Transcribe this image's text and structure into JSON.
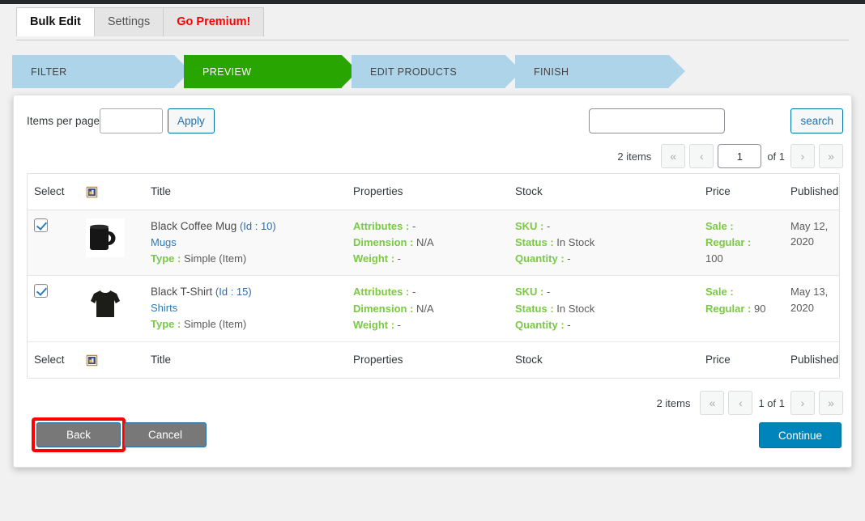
{
  "tabs": [
    {
      "label": "Bulk Edit",
      "state": "active"
    },
    {
      "label": "Settings",
      "state": "inactive"
    },
    {
      "label": "Go Premium!",
      "state": "premium"
    }
  ],
  "steps": [
    {
      "label": "FILTER",
      "current": false
    },
    {
      "label": "PREVIEW",
      "current": true
    },
    {
      "label": "EDIT PRODUCTS",
      "current": false
    },
    {
      "label": "FINISH",
      "current": false
    }
  ],
  "toolbar": {
    "items_per_page_label": "Items per page:",
    "items_per_page_value": "",
    "apply_label": "Apply",
    "search_value": "",
    "search_label": "search"
  },
  "pager_top": {
    "count": "2 items",
    "first": "«",
    "prev": "‹",
    "page": "1",
    "of": "of 1",
    "next": "›",
    "last": "»"
  },
  "pager_bottom": {
    "count": "2 items",
    "first": "«",
    "prev": "‹",
    "page_of": "1 of 1",
    "next": "›",
    "last": "»"
  },
  "table": {
    "headers": {
      "select": "Select",
      "image": "image-icon",
      "title": "Title",
      "properties": "Properties",
      "stock": "Stock",
      "price": "Price",
      "published": "Published"
    },
    "rows": [
      {
        "selected": true,
        "thumb": "black-coffee-mug",
        "title": "Black Coffee Mug",
        "id_label": "(Id : 10)",
        "category": "Mugs",
        "type_label": "Type :",
        "type_value": "Simple (Item)",
        "attributes_label": "Attributes :",
        "attributes_value": "-",
        "dimension_label": "Dimension :",
        "dimension_value": "N/A",
        "weight_label": "Weight :",
        "weight_value": "-",
        "sku_label": "SKU :",
        "sku_value": "-",
        "status_label": "Status :",
        "status_value": "In Stock",
        "quantity_label": "Quantity :",
        "quantity_value": "-",
        "sale_label": "Sale :",
        "sale_value": "",
        "regular_label": "Regular :",
        "regular_value": "100",
        "published": "May 12, 2020"
      },
      {
        "selected": true,
        "thumb": "black-t-shirt",
        "title": "Black T-Shirt",
        "id_label": "(Id : 15)",
        "category": "Shirts",
        "type_label": "Type :",
        "type_value": "Simple (Item)",
        "attributes_label": "Attributes :",
        "attributes_value": "-",
        "dimension_label": "Dimension :",
        "dimension_value": "N/A",
        "weight_label": "Weight :",
        "weight_value": "-",
        "sku_label": "SKU :",
        "sku_value": "-",
        "status_label": "Status :",
        "status_value": "In Stock",
        "quantity_label": "Quantity :",
        "quantity_value": "-",
        "sale_label": "Sale :",
        "sale_value": "",
        "regular_label": "Regular :",
        "regular_value": "90",
        "published": "May 13, 2020"
      }
    ]
  },
  "footer": {
    "back_label": "Back",
    "cancel_label": "Cancel",
    "continue_label": "Continue"
  },
  "colors": {
    "step_active": "#28a500",
    "step_inactive": "#aed4ea",
    "label_green": "#7ac943",
    "link_blue": "#2b7bb9",
    "primary_blue": "#0085ba",
    "premium_red": "#ff0000",
    "highlight_red": "#ff0000"
  }
}
